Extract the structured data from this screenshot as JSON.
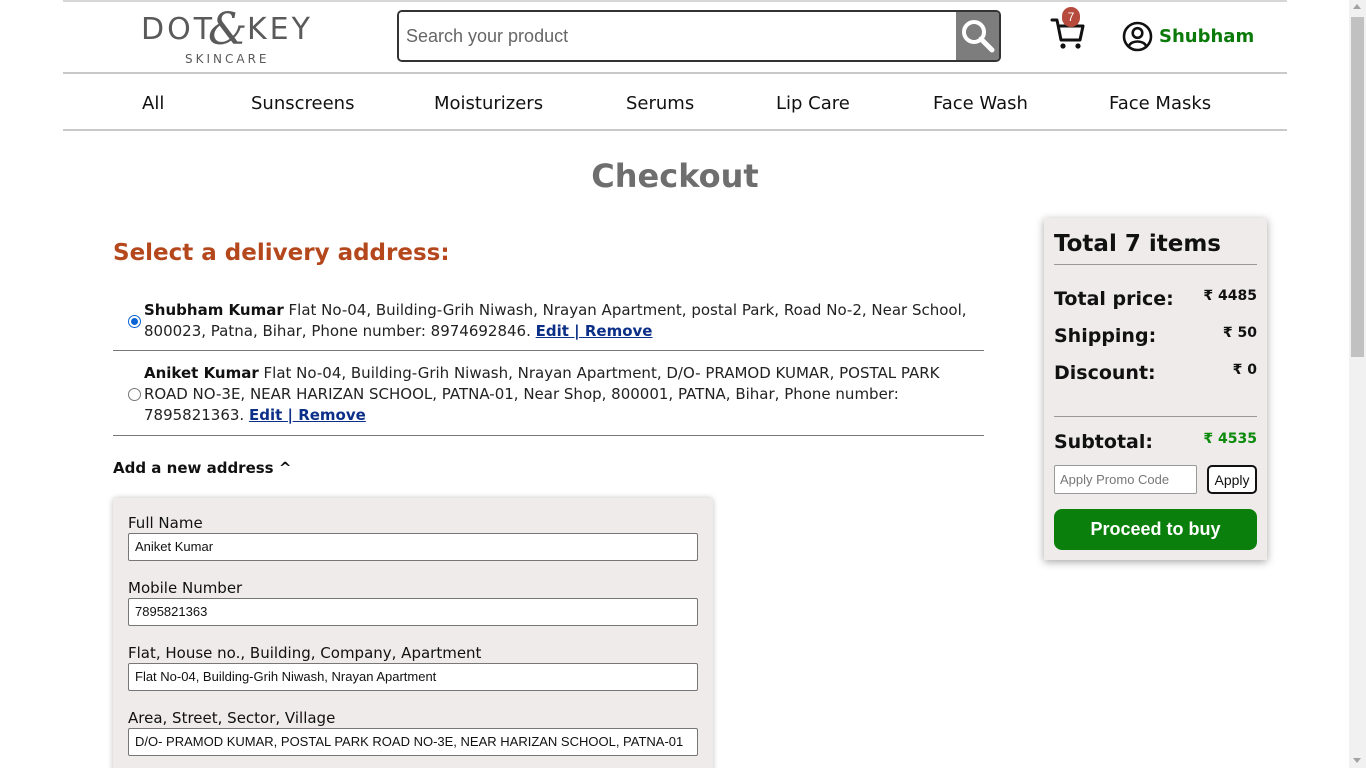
{
  "header": {
    "logo_main_left": "DOT",
    "logo_amp": "&",
    "logo_main_right": "KEY",
    "logo_sub": "SKINCARE",
    "search_placeholder": "Search your product",
    "cart_count": "7",
    "user_name": "Shubham"
  },
  "nav": {
    "items": [
      "All",
      "Sunscreens",
      "Moisturizers",
      "Serums",
      "Lip Care",
      "Face Wash",
      "Face Masks"
    ]
  },
  "page": {
    "title": "Checkout"
  },
  "addresses": {
    "title": "Select a delivery address:",
    "list": [
      {
        "name": "Shubham Kumar",
        "details": "Flat No-04, Building-Grih Niwash, Nrayan Apartment, postal Park, Road No-2, Near School, 800023, Patna, Bihar, Phone number: 8974692846.",
        "actions": "Edit | Remove",
        "selected": true
      },
      {
        "name": "Aniket Kumar",
        "details": "Flat No-04, Building-Grih Niwash, Nrayan Apartment, D/O- PRAMOD KUMAR, POSTAL PARK ROAD NO-3E, NEAR HARIZAN SCHOOL, PATNA-01, Near Shop, 800001, PATNA, Bihar, Phone number: 7895821363.",
        "actions": "Edit | Remove",
        "selected": false
      }
    ],
    "add_new_label": "Add a new address ^"
  },
  "form": {
    "full_name_label": "Full Name",
    "full_name_value": "Aniket Kumar",
    "mobile_label": "Mobile Number",
    "mobile_value": "7895821363",
    "flat_label": "Flat, House no., Building, Company, Apartment",
    "flat_value": "Flat No-04, Building-Grih Niwash, Nrayan Apartment",
    "area_label": "Area, Street, Sector, Village",
    "area_value": "D/O- PRAMOD KUMAR, POSTAL PARK ROAD NO-3E, NEAR HARIZAN SCHOOL, PATNA-01"
  },
  "summary": {
    "title": "Total 7 items",
    "total_price_label": "Total price:",
    "total_price_value": "₹ 4485",
    "shipping_label": "Shipping:",
    "shipping_value": "₹ 50",
    "discount_label": "Discount:",
    "discount_value": "₹ 0",
    "subtotal_label": "Subtotal:",
    "subtotal_value": "₹ 4535",
    "promo_placeholder": "Apply Promo Code",
    "apply_label": "Apply",
    "buy_label": "Proceed to buy"
  },
  "colors": {
    "accent_green": "#0b7f0b",
    "section_title": "#b5471c",
    "cart_badge": "#b64a3d",
    "link": "#0c2f87"
  }
}
